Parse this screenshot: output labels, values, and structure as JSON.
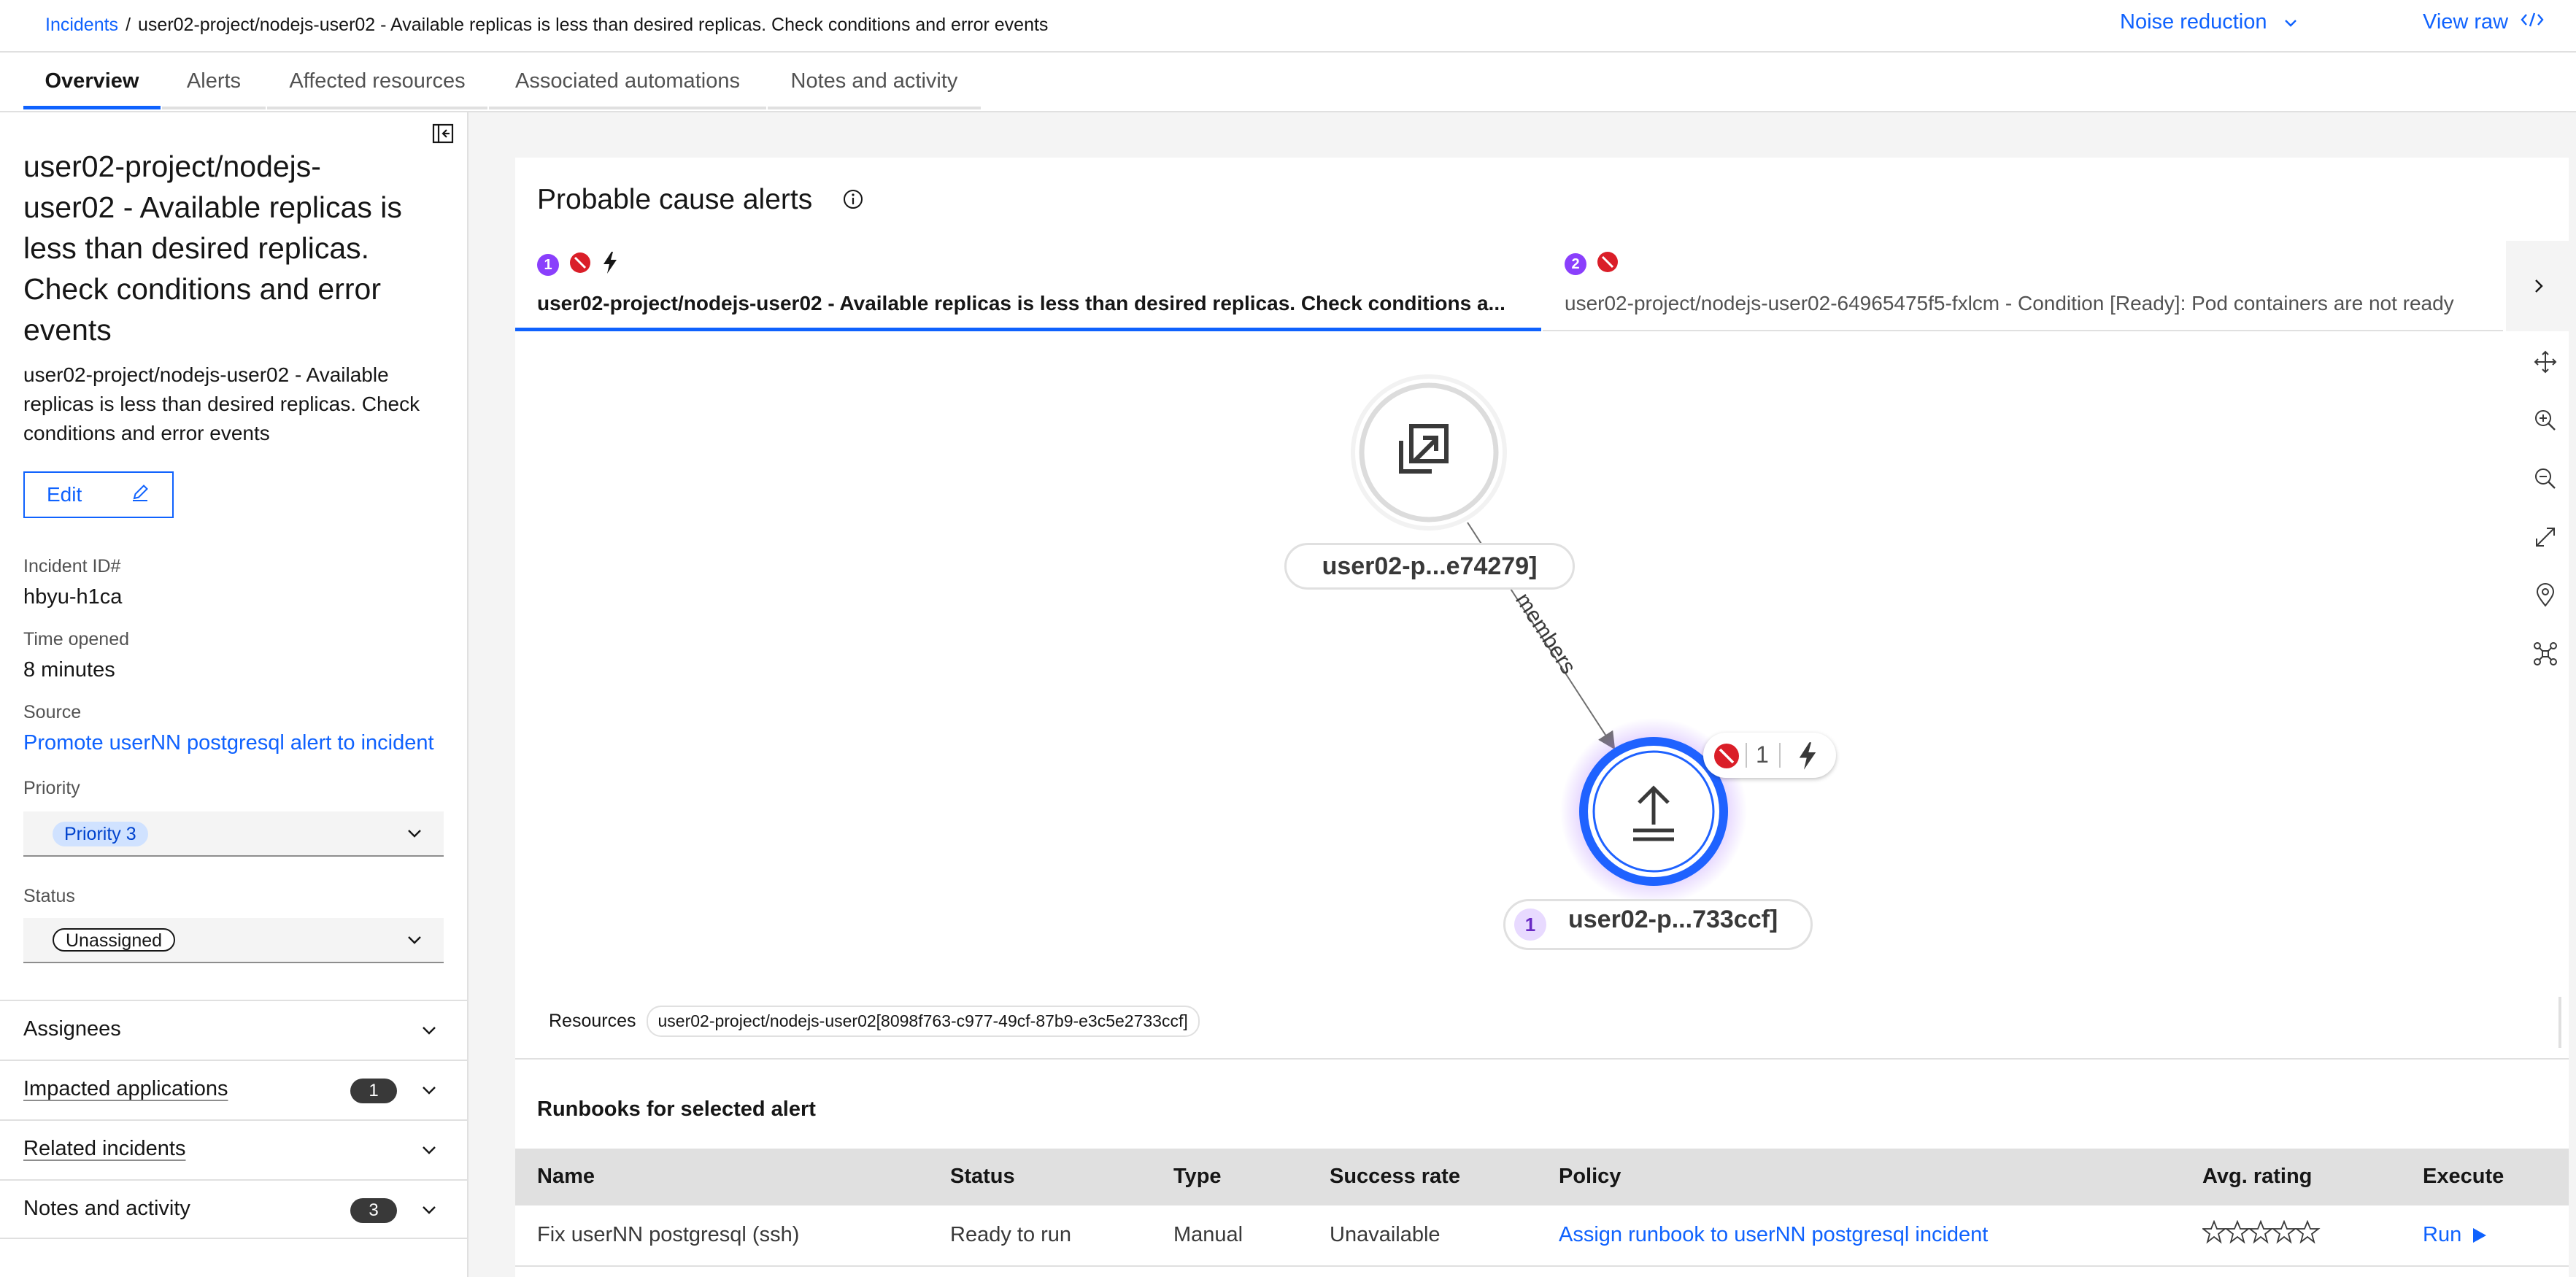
{
  "breadcrumb": {
    "root": "Incidents",
    "separator": "/",
    "current": "user02-project/nodejs-user02 - Available replicas is less than desired replicas. Check conditions and error events"
  },
  "header_actions": {
    "noise_reduction": "Noise reduction",
    "view_raw": "View raw"
  },
  "tabs": [
    {
      "label": "Overview",
      "active": true
    },
    {
      "label": "Alerts",
      "active": false
    },
    {
      "label": "Affected resources",
      "active": false
    },
    {
      "label": "Associated automations",
      "active": false
    },
    {
      "label": "Notes and activity",
      "active": false
    }
  ],
  "incident": {
    "title_lines": [
      "user02-project/nodejs-",
      "user02 - Available replicas is",
      "less than desired replicas.",
      "Check conditions and error",
      "events"
    ],
    "description_lines": [
      "user02-project/nodejs-user02 - Available",
      "replicas is less than desired replicas. Check",
      "conditions and error events"
    ],
    "edit_label": "Edit",
    "id_label": "Incident ID#",
    "id_value": "hbyu-h1ca",
    "time_label": "Time opened",
    "time_value": "8 minutes",
    "source_label": "Source",
    "source_value": "Promote userNN postgresql alert to incident",
    "priority_label": "Priority",
    "priority_value": "Priority 3",
    "status_label": "Status",
    "status_value": "Unassigned"
  },
  "accordions": [
    {
      "title": "Assignees",
      "badge": null
    },
    {
      "title": "Impacted applications",
      "badge": "1"
    },
    {
      "title": "Related incidents",
      "badge": null
    },
    {
      "title": "Notes and activity",
      "badge": "3"
    }
  ],
  "probable_cause": {
    "title": "Probable cause alerts",
    "alert_tabs": [
      {
        "number": "1",
        "text": "user02-project/nodejs-user02 - Available replicas is less than desired replicas. Check conditions a...",
        "selected": true
      },
      {
        "number": "2",
        "text": "user02-project/nodejs-user02-64965475f5-fxlcm - Condition [Ready]: Pod containers are not ready",
        "selected": false
      }
    ]
  },
  "topology": {
    "node_top_label": "user02-p...e74279]",
    "edge_label": "members",
    "node_main_label": "user02-p...733ccf]",
    "node_main_number": "1",
    "badge_count": "1"
  },
  "resources": {
    "label": "Resources",
    "tag": "user02-project/nodejs-user02[8098f763-c977-49cf-87b9-e3c5e2733ccf]"
  },
  "runbooks": {
    "title": "Runbooks for selected alert",
    "columns": [
      "Name",
      "Status",
      "Type",
      "Success rate",
      "Policy",
      "Avg. rating",
      "Execute"
    ],
    "rows": [
      {
        "name": "Fix userNN postgresql (ssh)",
        "status": "Ready to run",
        "type": "Manual",
        "success_rate": "Unavailable",
        "policy": "Assign runbook to userNN postgresql incident",
        "rating_stars": 0,
        "execute": "Run"
      }
    ]
  },
  "colors": {
    "link_blue": "#0f62fe",
    "error_red": "#da1e28",
    "purple_badge": "#8a3ffc",
    "panel_gray": "#f4f4f4"
  }
}
